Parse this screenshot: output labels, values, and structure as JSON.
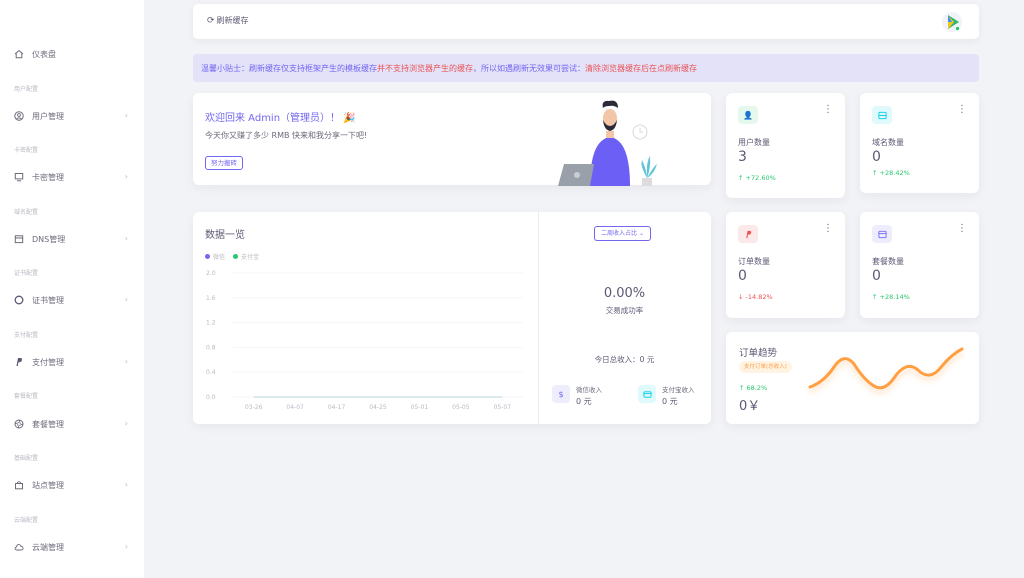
{
  "sidebar": {
    "dashboard": "仪表盘",
    "sections": [
      {
        "header": "用户配置",
        "label": "用户管理"
      },
      {
        "header": "卡密配置",
        "label": "卡密管理"
      },
      {
        "header": "域名配置",
        "label": "DNS管理"
      },
      {
        "header": "证书配置",
        "label": "证书管理"
      },
      {
        "header": "支付配置",
        "label": "支付管理"
      },
      {
        "header": "套餐配置",
        "label": "套餐管理"
      },
      {
        "header": "基础配置",
        "label": "站点管理"
      },
      {
        "header": "云端配置",
        "label": "云端管理"
      }
    ]
  },
  "topbar": {
    "refresh_label": "刷新缓存"
  },
  "notice": {
    "prefix": "温馨小贴士：刷新缓存仅支持框架产生的模板缓存",
    "warn1": "并不支持浏览器产生的缓存",
    "middle": "，所以如遇刷新无效果可尝试：",
    "warn2": "清除浏览器缓存后在点刷新缓存"
  },
  "welcome": {
    "title": "欢迎回来 Admin（管理员）！",
    "subtitle": "今天你又赚了多少 RMB 快来和我分享一下吧!",
    "button": "努力搬砖"
  },
  "stats": [
    {
      "label": "用户数量",
      "value": "3",
      "change": "+72.60%",
      "direction": "up",
      "icon": "user-icon",
      "color": "#28c76f",
      "bg": "#e5f8ed"
    },
    {
      "label": "域名数量",
      "value": "0",
      "change": "+28.42%",
      "direction": "up",
      "icon": "server-icon",
      "color": "#00cfe8",
      "bg": "#e0f9fc"
    },
    {
      "label": "订单数量",
      "value": "0",
      "change": "-14.82%",
      "direction": "down",
      "icon": "paypal-icon",
      "color": "#ea5455",
      "bg": "#fceaea"
    },
    {
      "label": "套餐数量",
      "value": "0",
      "change": "+28.14%",
      "direction": "up",
      "icon": "package-icon",
      "color": "#7367f0",
      "bg": "#eeedfd"
    }
  ],
  "overview": {
    "title": "数据一览",
    "dropdown": "二周收入占比",
    "rate": "0.00%",
    "rate_label": "交易成功率",
    "today": "今日总收入：0 元",
    "wechat": {
      "label": "微信收入",
      "value": "0 元"
    },
    "alipay": {
      "label": "支付宝收入",
      "value": "0 元"
    }
  },
  "chart_data": {
    "type": "line",
    "x": [
      "03-26",
      "04-07",
      "04-17",
      "04-25",
      "05-01",
      "05-05",
      "05-07"
    ],
    "series": [
      {
        "name": "微信",
        "values": [
          0,
          0,
          0,
          0,
          0,
          0,
          0
        ],
        "color": "#7367f0"
      },
      {
        "name": "支付宝",
        "values": [
          0,
          0,
          0,
          0,
          0,
          0,
          0
        ],
        "color": "#28c76f"
      }
    ],
    "yticks": [
      "2.0",
      "1.6",
      "1.2",
      "0.8",
      "0.4",
      "0.0"
    ],
    "ylim": [
      0,
      2.0
    ],
    "grid": true
  },
  "trend": {
    "title": "订单趋势",
    "badge": "支付订单(总收入)",
    "change": "68.2%",
    "value": "0￥",
    "color": "#ff9f43"
  }
}
